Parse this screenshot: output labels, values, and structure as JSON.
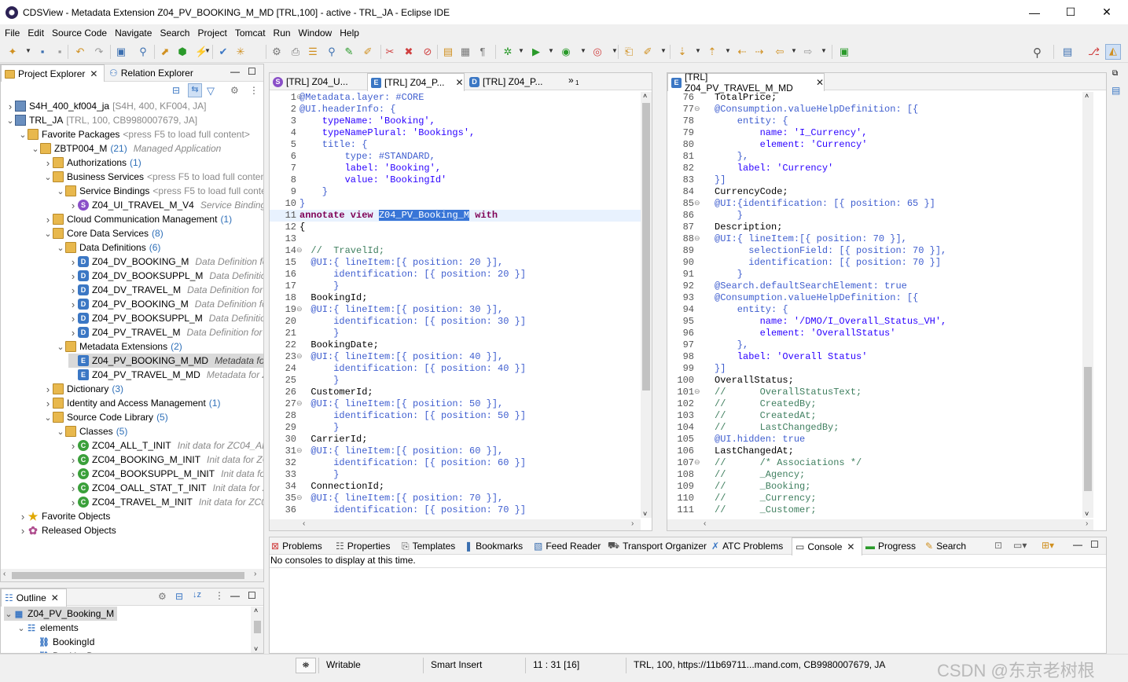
{
  "window": {
    "title": "CDSView - Metadata Extension Z04_PV_BOOKING_M_MD [TRL,100] - active - TRL_JA - Eclipse IDE",
    "minimize": "—",
    "maximize": "☐",
    "close": "✕"
  },
  "menu": [
    "File",
    "Edit",
    "Source Code",
    "Navigate",
    "Search",
    "Project",
    "Tomcat",
    "Run",
    "Window",
    "Help"
  ],
  "project_explorer": {
    "tabs": [
      {
        "label": "Project Explorer"
      },
      {
        "label": "Relation Explorer"
      }
    ],
    "tree": [
      {
        "label": "S4H_400_kf004_ja",
        "extra": "[S4H, 400, KF004, JA]",
        "icon": "proj",
        "toggle": "›",
        "indent": 0
      },
      {
        "label": "TRL_JA",
        "extra": "[TRL, 100, CB9980007679, JA]",
        "icon": "proj",
        "toggle": "⌄",
        "indent": 0
      },
      {
        "label": "Favorite Packages",
        "extra": "<press F5 to load full content>",
        "icon": "folder",
        "toggle": "⌄",
        "indent": 1
      },
      {
        "label": "ZBTP004_M",
        "count": "(21)",
        "desc": "Managed Application",
        "icon": "folder",
        "toggle": "⌄",
        "indent": 2
      },
      {
        "label": "Authorizations",
        "count": "(1)",
        "icon": "folder",
        "toggle": "›",
        "indent": 3
      },
      {
        "label": "Business Services",
        "extra": "<press F5 to load full content>",
        "icon": "folder",
        "toggle": "⌄",
        "indent": 3
      },
      {
        "label": "Service Bindings",
        "extra": "<press F5 to load full content>",
        "icon": "folder",
        "toggle": "⌄",
        "indent": 4
      },
      {
        "label": "Z04_UI_TRAVEL_M_V4",
        "desc": "Service Binding (",
        "icon": "sico",
        "toggle": "›",
        "indent": 5
      },
      {
        "label": "Cloud Communication Management",
        "count": "(1)",
        "icon": "folder",
        "toggle": "›",
        "indent": 3
      },
      {
        "label": "Core Data Services",
        "count": "(8)",
        "icon": "folder",
        "toggle": "⌄",
        "indent": 3
      },
      {
        "label": "Data Definitions",
        "count": "(6)",
        "icon": "folder",
        "toggle": "⌄",
        "indent": 4
      },
      {
        "label": "Z04_DV_BOOKING_M",
        "desc": "Data Definition for",
        "icon": "dico",
        "toggle": "›",
        "indent": 5
      },
      {
        "label": "Z04_DV_BOOKSUPPL_M",
        "desc": "Data Definition",
        "icon": "dico",
        "toggle": "›",
        "indent": 5
      },
      {
        "label": "Z04_DV_TRAVEL_M",
        "desc": "Data Definition for Z",
        "icon": "dico",
        "toggle": "›",
        "indent": 5
      },
      {
        "label": "Z04_PV_BOOKING_M",
        "desc": "Data Definition for",
        "icon": "dico",
        "toggle": "›",
        "indent": 5
      },
      {
        "label": "Z04_PV_BOOKSUPPL_M",
        "desc": "Data Definition",
        "icon": "dico",
        "toggle": "›",
        "indent": 5
      },
      {
        "label": "Z04_PV_TRAVEL_M",
        "desc": "Data Definition for Z",
        "icon": "dico",
        "toggle": "›",
        "indent": 5
      },
      {
        "label": "Metadata Extensions",
        "count": "(2)",
        "icon": "folder",
        "toggle": "⌄",
        "indent": 4
      },
      {
        "label": "Z04_PV_BOOKING_M_MD",
        "desc": "Metadata for",
        "icon": "eico",
        "toggle": "",
        "indent": 5,
        "selected": true
      },
      {
        "label": "Z04_PV_TRAVEL_M_MD",
        "desc": "Metadata for Z0",
        "icon": "eico",
        "toggle": "",
        "indent": 5
      },
      {
        "label": "Dictionary",
        "count": "(3)",
        "icon": "folder",
        "toggle": "›",
        "indent": 3
      },
      {
        "label": "Identity and Access Management",
        "count": "(1)",
        "icon": "folder",
        "toggle": "›",
        "indent": 3
      },
      {
        "label": "Source Code Library",
        "count": "(5)",
        "icon": "folder",
        "toggle": "⌄",
        "indent": 3
      },
      {
        "label": "Classes",
        "count": "(5)",
        "icon": "folder",
        "toggle": "⌄",
        "indent": 4
      },
      {
        "label": "ZC04_ALL_T_INIT",
        "desc": "Init data for ZC04_ALL_",
        "icon": "cico",
        "toggle": "›",
        "indent": 5
      },
      {
        "label": "ZC04_BOOKING_M_INIT",
        "desc": "Init data for ZC0",
        "icon": "cico",
        "toggle": "›",
        "indent": 5
      },
      {
        "label": "ZC04_BOOKSUPPL_M_INIT",
        "desc": "Init data for Z",
        "icon": "cico",
        "toggle": "›",
        "indent": 5
      },
      {
        "label": "ZC04_OALL_STAT_T_INIT",
        "desc": "Init data for ZC",
        "icon": "cico",
        "toggle": "›",
        "indent": 5
      },
      {
        "label": "ZC04_TRAVEL_M_INIT",
        "desc": "Init data for ZC04_",
        "icon": "cico",
        "toggle": "›",
        "indent": 5
      },
      {
        "label": "Favorite Objects",
        "icon": "star",
        "toggle": "›",
        "indent": 1
      },
      {
        "label": "Released Objects",
        "icon": "gear",
        "toggle": "›",
        "indent": 1
      }
    ]
  },
  "outline": {
    "tab": "Outline",
    "items": [
      {
        "label": "Z04_PV_Booking_M",
        "indent": 0,
        "toggle": "⌄",
        "selected": true
      },
      {
        "label": "elements",
        "indent": 1,
        "toggle": "⌄"
      },
      {
        "label": "BookingId",
        "indent": 2,
        "toggle": ""
      },
      {
        "label": "BookingDate",
        "indent": 2,
        "toggle": ""
      }
    ]
  },
  "editor_left": {
    "tabs": [
      {
        "label": "[TRL] Z04_U..."
      },
      {
        "label": "[TRL] Z04_P..."
      },
      {
        "label": "[TRL] Z04_P..."
      }
    ],
    "overflow": "»",
    "overflow_count": "1",
    "lines": [
      {
        "n": "1",
        "fold": "⊖",
        "t": "@Metadata.layer: #CORE",
        "c": "an"
      },
      {
        "n": "2",
        "t": "@UI.headerInfo: {",
        "c": "an"
      },
      {
        "n": "3",
        "t": "    typeName: 'Booking',",
        "c": "st"
      },
      {
        "n": "4",
        "t": "    typeNamePlural: 'Bookings',",
        "c": "st"
      },
      {
        "n": "5",
        "t": "    title: {",
        "c": "an"
      },
      {
        "n": "6",
        "t": "        type: #STANDARD,",
        "c": "an"
      },
      {
        "n": "7",
        "t": "        label: 'Booking',",
        "c": "st"
      },
      {
        "n": "8",
        "t": "        value: 'BookingId'",
        "c": "st"
      },
      {
        "n": "9",
        "t": "    }",
        "c": "an"
      },
      {
        "n": "10",
        "t": "}",
        "c": "an"
      },
      {
        "n": "11",
        "t": "annotate view ",
        "c": "kw",
        "sel": "Z04_PV_Booking_M",
        "rest": " with",
        "current": true
      },
      {
        "n": "12",
        "t": "{",
        "c": ""
      },
      {
        "n": "13",
        "t": "",
        "c": ""
      },
      {
        "n": "14",
        "fold": "⊖",
        "t": "  //  TravelId;",
        "c": "cm"
      },
      {
        "n": "15",
        "t": "  @UI:{ lineItem:[{ position: 20 }],",
        "c": "an"
      },
      {
        "n": "16",
        "t": "      identification: [{ position: 20 }]",
        "c": "an"
      },
      {
        "n": "17",
        "t": "      }",
        "c": "an"
      },
      {
        "n": "18",
        "t": "  BookingId;",
        "c": ""
      },
      {
        "n": "19",
        "fold": "⊖",
        "t": "  @UI:{ lineItem:[{ position: 30 }],",
        "c": "an"
      },
      {
        "n": "20",
        "t": "      identification: [{ position: 30 }]",
        "c": "an"
      },
      {
        "n": "21",
        "t": "      }",
        "c": "an"
      },
      {
        "n": "22",
        "t": "  BookingDate;",
        "c": ""
      },
      {
        "n": "23",
        "fold": "⊖",
        "t": "  @UI:{ lineItem:[{ position: 40 }],",
        "c": "an"
      },
      {
        "n": "24",
        "t": "      identification: [{ position: 40 }]",
        "c": "an"
      },
      {
        "n": "25",
        "t": "      }",
        "c": "an"
      },
      {
        "n": "26",
        "t": "  CustomerId;",
        "c": ""
      },
      {
        "n": "27",
        "fold": "⊖",
        "t": "  @UI:{ lineItem:[{ position: 50 }],",
        "c": "an"
      },
      {
        "n": "28",
        "t": "      identification: [{ position: 50 }]",
        "c": "an"
      },
      {
        "n": "29",
        "t": "      }",
        "c": "an"
      },
      {
        "n": "30",
        "t": "  CarrierId;",
        "c": ""
      },
      {
        "n": "31",
        "fold": "⊖",
        "t": "  @UI:{ lineItem:[{ position: 60 }],",
        "c": "an"
      },
      {
        "n": "32",
        "t": "      identification: [{ position: 60 }]",
        "c": "an"
      },
      {
        "n": "33",
        "t": "      }",
        "c": "an"
      },
      {
        "n": "34",
        "t": "  ConnectionId;",
        "c": ""
      },
      {
        "n": "35",
        "fold": "⊖",
        "t": "  @UI:{ lineItem:[{ position: 70 }],",
        "c": "an"
      },
      {
        "n": "36",
        "t": "      identification: [{ position: 70 }]",
        "c": "an"
      }
    ]
  },
  "editor_right": {
    "tab": "[TRL] Z04_PV_TRAVEL_M_MD",
    "lines": [
      {
        "n": "76",
        "t": "TotalPrice;",
        "c": ""
      },
      {
        "n": "77",
        "fold": "⊖",
        "t": "@Consumption.valueHelpDefinition: [{",
        "c": "an"
      },
      {
        "n": "78",
        "t": "    entity: {",
        "c": "an"
      },
      {
        "n": "79",
        "t": "        name: 'I_Currency',",
        "c": "st"
      },
      {
        "n": "80",
        "t": "        element: 'Currency'",
        "c": "st"
      },
      {
        "n": "81",
        "t": "    },",
        "c": "an"
      },
      {
        "n": "82",
        "t": "    label: 'Currency'",
        "c": "st"
      },
      {
        "n": "83",
        "t": "}]",
        "c": "an"
      },
      {
        "n": "84",
        "t": "CurrencyCode;",
        "c": ""
      },
      {
        "n": "85",
        "fold": "⊖",
        "t": "@UI:{identification: [{ position: 65 }]",
        "c": "an"
      },
      {
        "n": "86",
        "t": "    }",
        "c": "an"
      },
      {
        "n": "87",
        "t": "Description;",
        "c": ""
      },
      {
        "n": "88",
        "fold": "⊖",
        "t": "@UI:{ lineItem:[{ position: 70 }],",
        "c": "an"
      },
      {
        "n": "89",
        "t": "      selectionField: [{ position: 70 }],",
        "c": "an"
      },
      {
        "n": "90",
        "t": "      identification: [{ position: 70 }]",
        "c": "an"
      },
      {
        "n": "91",
        "t": "    }",
        "c": "an"
      },
      {
        "n": "92",
        "t": "@Search.defaultSearchElement: true",
        "c": "an"
      },
      {
        "n": "93",
        "t": "@Consumption.valueHelpDefinition: [{",
        "c": "an"
      },
      {
        "n": "94",
        "t": "    entity: {",
        "c": "an"
      },
      {
        "n": "95",
        "t": "        name: '/DMO/I_Overall_Status_VH',",
        "c": "st"
      },
      {
        "n": "96",
        "t": "        element: 'OverallStatus'",
        "c": "st"
      },
      {
        "n": "97",
        "t": "    },",
        "c": "an"
      },
      {
        "n": "98",
        "t": "    label: 'Overall Status'",
        "c": "st"
      },
      {
        "n": "99",
        "t": "}]",
        "c": "an"
      },
      {
        "n": "100",
        "t": "OverallStatus;",
        "c": ""
      },
      {
        "n": "101",
        "fold": "⊖",
        "t": "//      OverallStatusText;",
        "c": "cm"
      },
      {
        "n": "102",
        "t": "//      CreatedBy;",
        "c": "cm"
      },
      {
        "n": "103",
        "t": "//      CreatedAt;",
        "c": "cm"
      },
      {
        "n": "104",
        "t": "//      LastChangedBy;",
        "c": "cm"
      },
      {
        "n": "105",
        "t": "@UI.hidden: true",
        "c": "an"
      },
      {
        "n": "106",
        "t": "LastChangedAt;",
        "c": ""
      },
      {
        "n": "107",
        "fold": "⊖",
        "t": "//      /* Associations */",
        "c": "cm"
      },
      {
        "n": "108",
        "t": "//      _Agency;",
        "c": "cm"
      },
      {
        "n": "109",
        "t": "//      _Booking;",
        "c": "cm"
      },
      {
        "n": "110",
        "t": "//      _Currency;",
        "c": "cm"
      },
      {
        "n": "111",
        "t": "//      _Customer;",
        "c": "cm"
      }
    ]
  },
  "bottom_panel": {
    "tabs": [
      {
        "label": "Problems",
        "icon": "problems-icon"
      },
      {
        "label": "Properties",
        "icon": "properties-icon"
      },
      {
        "label": "Templates",
        "icon": "templates-icon"
      },
      {
        "label": "Bookmarks",
        "icon": "bookmarks-icon"
      },
      {
        "label": "Feed Reader",
        "icon": "feed-reader-icon"
      },
      {
        "label": "Transport Organizer",
        "icon": "transport-organizer-icon"
      },
      {
        "label": "ATC Problems",
        "icon": "atc-problems-icon"
      },
      {
        "label": "Console",
        "icon": "console-icon",
        "active": true
      },
      {
        "label": "Progress",
        "icon": "progress-icon"
      },
      {
        "label": "Search",
        "icon": "search-icon"
      }
    ],
    "message": "No consoles to display at this time."
  },
  "status": {
    "writable": "Writable",
    "insert": "Smart Insert",
    "position": "11 : 31 [16]",
    "system": "TRL, 100, https://11b69711...mand.com, CB9980007679, JA"
  },
  "watermark": "CSDN @东京老树根",
  "colors": {
    "keyword": "#7f0055",
    "annotation": "#3f5ecf",
    "string": "#2a00ff",
    "comment": "#3f7f5f",
    "selection": "#3875d7"
  }
}
